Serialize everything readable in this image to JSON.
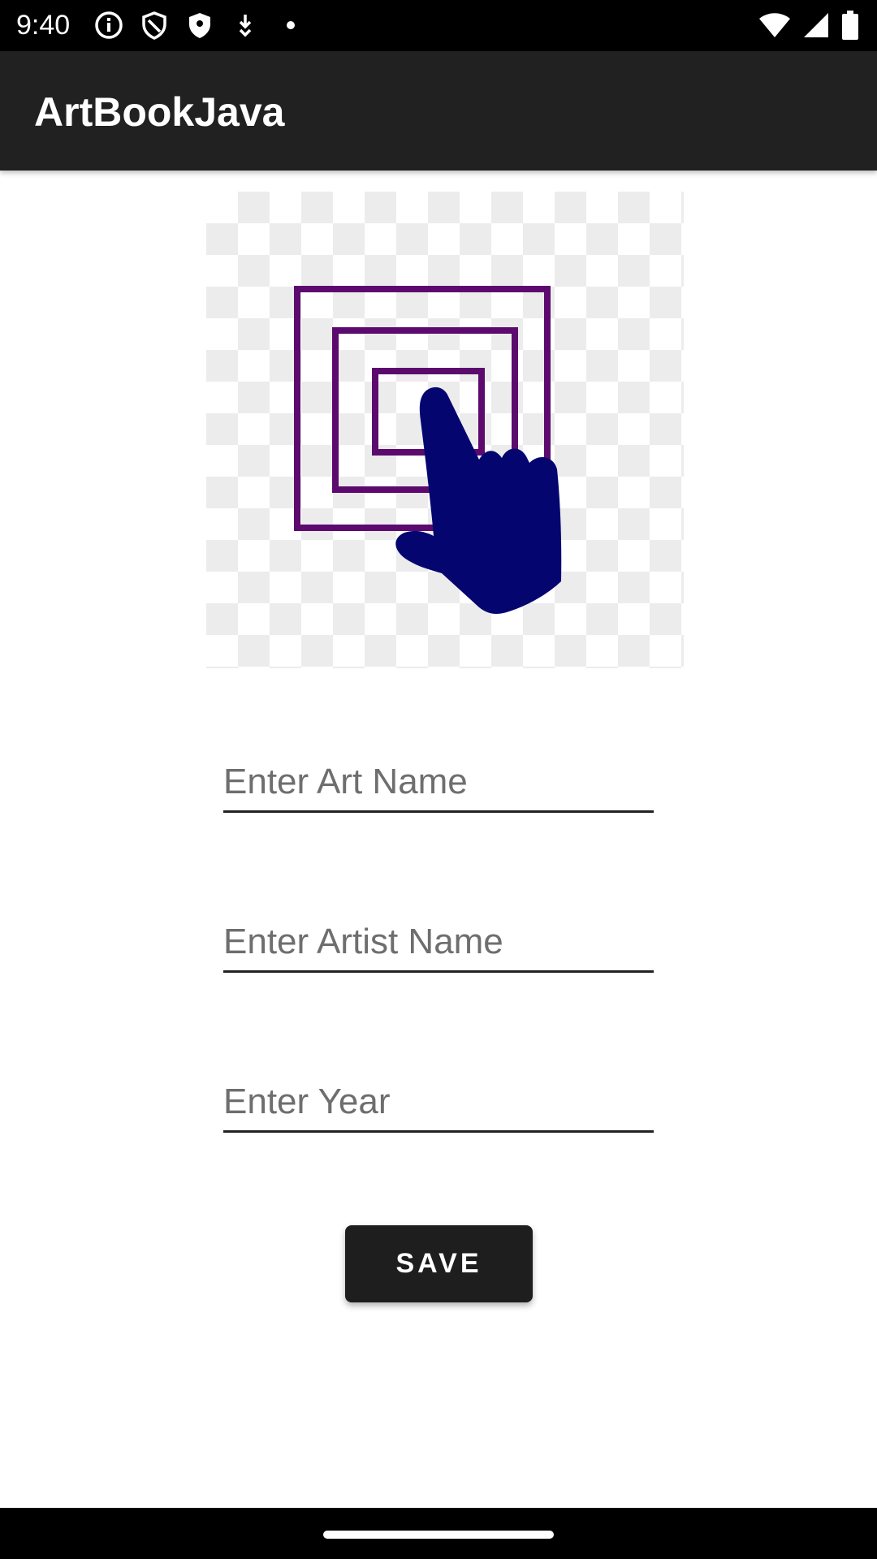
{
  "status_bar": {
    "time": "9:40",
    "left_icons": [
      "info-icon",
      "shield-outline-icon",
      "shield-filled-icon",
      "download-arrow-icon",
      "dot-icon"
    ],
    "right_icons": [
      "wifi-icon",
      "cellular-signal-icon",
      "battery-icon"
    ]
  },
  "app_bar": {
    "title": "ArtBookJava"
  },
  "image_selector": {
    "icon": "select-image-placeholder",
    "colors": {
      "squares": "#5c0a6e",
      "hand": "#050570",
      "checker": "#ececec"
    }
  },
  "form": {
    "art_name_placeholder": "Enter Art Name",
    "artist_name_placeholder": "Enter Artist Name",
    "year_placeholder": "Enter Year",
    "save_label": "SAVE"
  },
  "colors": {
    "app_bar": "#212121",
    "button": "#1e1e1e",
    "status_bar": "#000000"
  }
}
